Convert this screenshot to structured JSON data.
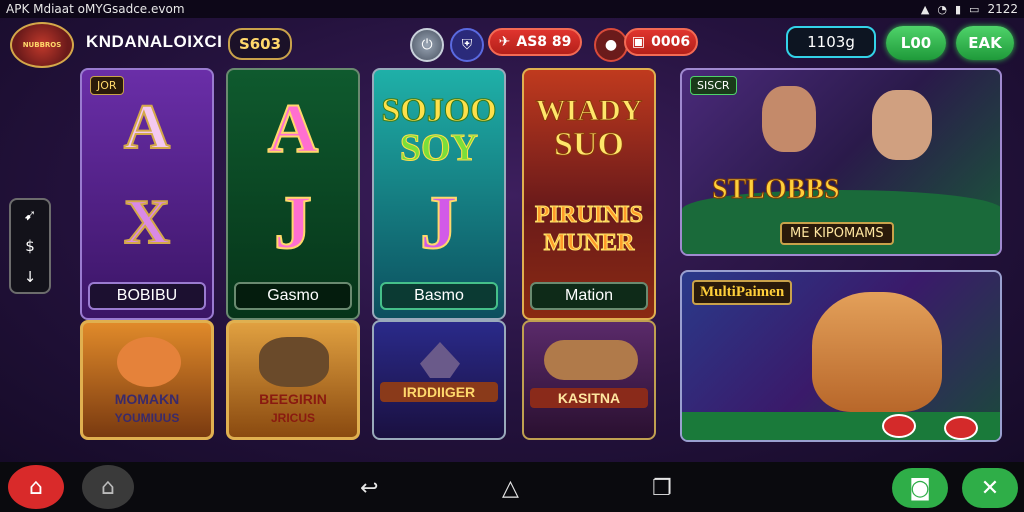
{
  "status_bar": {
    "left_text": "APK Mdiaat oMYGsadce.evom",
    "time": "2122",
    "icons": [
      "android-icon",
      "wifi-icon",
      "signal-icon",
      "battery-icon"
    ]
  },
  "top_bar": {
    "logo_text": "NUBBROS",
    "brand": "KNDANALOIXCI",
    "coins": "S603",
    "red_pill_1": "AS8 89",
    "red_pill_2": "0006",
    "dark_pill": "1103g",
    "green_btn_1": "L00",
    "green_btn_2": "EAK"
  },
  "games": [
    {
      "tag": "JOR",
      "top": "A",
      "middle": "X",
      "label": "BOBIBU"
    },
    {
      "top": "A",
      "middle": "J",
      "label": "Gasmo"
    },
    {
      "top": "SOJOO",
      "top2": "SOY",
      "middle": "J",
      "label": "Basmo"
    },
    {
      "top": "WIADY",
      "top2": "SUO",
      "middle": "PIRUINIS",
      "middle2": "MUNER",
      "label": "Mation"
    }
  ],
  "small_games": [
    {
      "title": "MOMAKN",
      "title2": "YOUMIUUS"
    },
    {
      "title": "BEEGIRIN",
      "title2": "JRICUS"
    },
    {
      "title": "IRDDIIGER"
    },
    {
      "title": "KASITNA"
    }
  ],
  "features": [
    {
      "tag": "SISCR",
      "title": "STLOBBS",
      "subtitle": "ME KIPOMAMS"
    },
    {
      "title": "MultiPaimen"
    }
  ],
  "colors": {
    "accent_gold": "#d4a84a",
    "green": "#2fae48",
    "red": "#d9302a",
    "cyan": "#33d3e8"
  }
}
